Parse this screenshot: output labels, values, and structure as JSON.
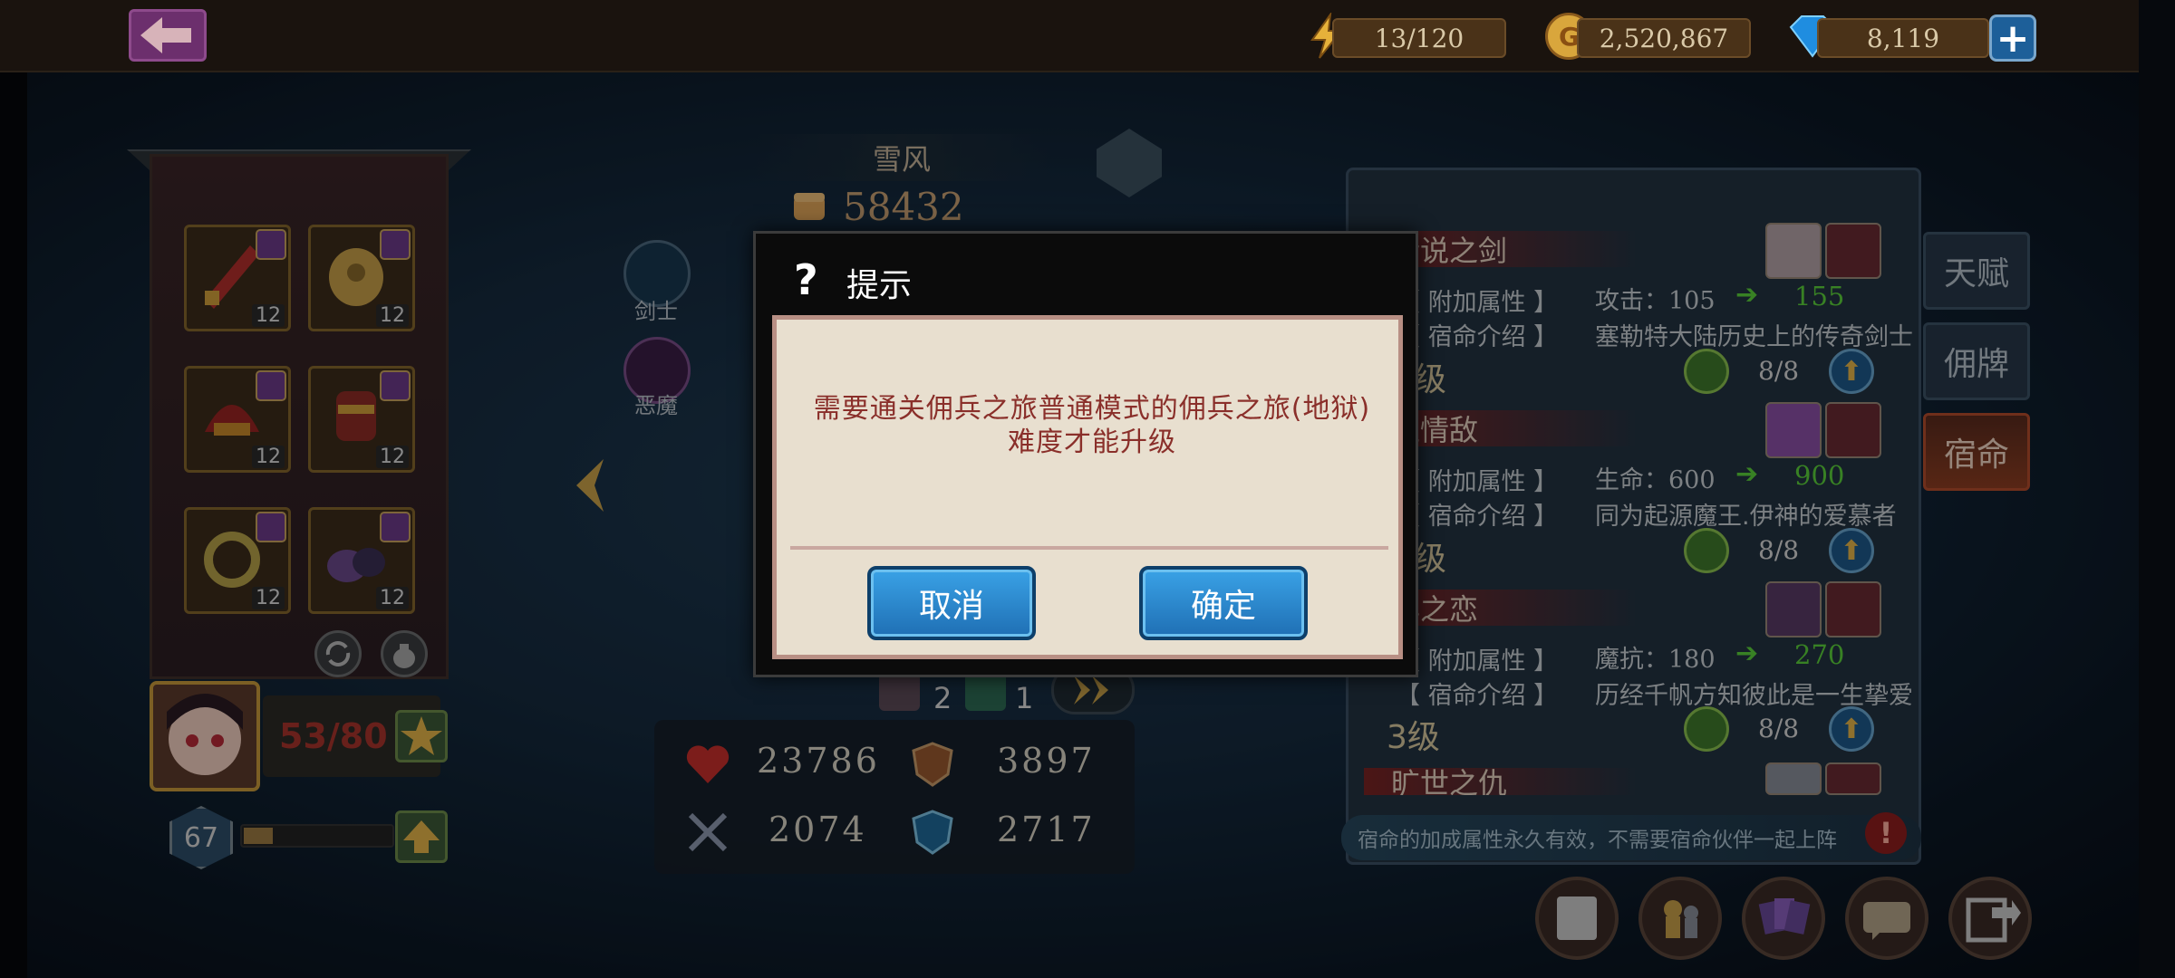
{
  "topbar": {
    "energy": "13/120",
    "gold": "2,520,867",
    "diamonds": "8,119"
  },
  "equipment": {
    "slots": [
      {
        "level": "12"
      },
      {
        "level": "12"
      },
      {
        "level": "12"
      },
      {
        "level": "12"
      },
      {
        "level": "12"
      },
      {
        "level": "12"
      }
    ]
  },
  "hero": {
    "name": "雪风",
    "power": "58432",
    "fragments": "53/80",
    "level": "67",
    "exp_fraction": 0.2,
    "classes": [
      {
        "label": "剑士"
      },
      {
        "label": "恶魔"
      }
    ],
    "stats": {
      "hp": "23786",
      "defense": "3897",
      "attack": "2074",
      "magic_defense": "2717"
    },
    "skill_counts": [
      "2",
      "1"
    ]
  },
  "fate": {
    "entries": [
      {
        "title": "传说之剑",
        "attr_label": "【 附加属性 】",
        "attr": "攻击：105",
        "next": "155",
        "intro_label": "【 宿命介绍 】",
        "intro": "塞勒特大陆历史上的传奇剑士",
        "level": "级",
        "count": "8/8"
      },
      {
        "title": "王情敌",
        "attr_label": "【 附加属性 】",
        "attr": "生命：600",
        "next": "900",
        "intro_label": "【 宿命介绍 】",
        "intro": "同为起源魔王.伊神的爱慕者",
        "level": "级",
        "count": "8/8"
      },
      {
        "title": "年之恋",
        "attr_label": "【 附加属性 】",
        "attr": "魔抗：180",
        "next": "270",
        "intro_label": "【 宿命介绍 】",
        "intro": "历经千帆方知彼此是一生挚爱",
        "level": "3级",
        "count": "8/8"
      },
      {
        "title": "旷世之仇"
      }
    ],
    "notice": "宿命的加成属性永久有效，不需要宿命伙伴一起上阵"
  },
  "side_tabs": [
    "天赋",
    "佣牌",
    "宿命"
  ],
  "dialog": {
    "title": "提示",
    "message_line1": "需要通关佣兵之旅普通模式的佣兵之旅(地狱)",
    "message_line2": "难度才能升级",
    "cancel": "取消",
    "confirm": "确定"
  },
  "colors": {
    "accent_red": "#8a2f2a",
    "button_blue": "#1f6fb4",
    "gold_text": "#c8a173",
    "green_value": "#5bd03a"
  }
}
